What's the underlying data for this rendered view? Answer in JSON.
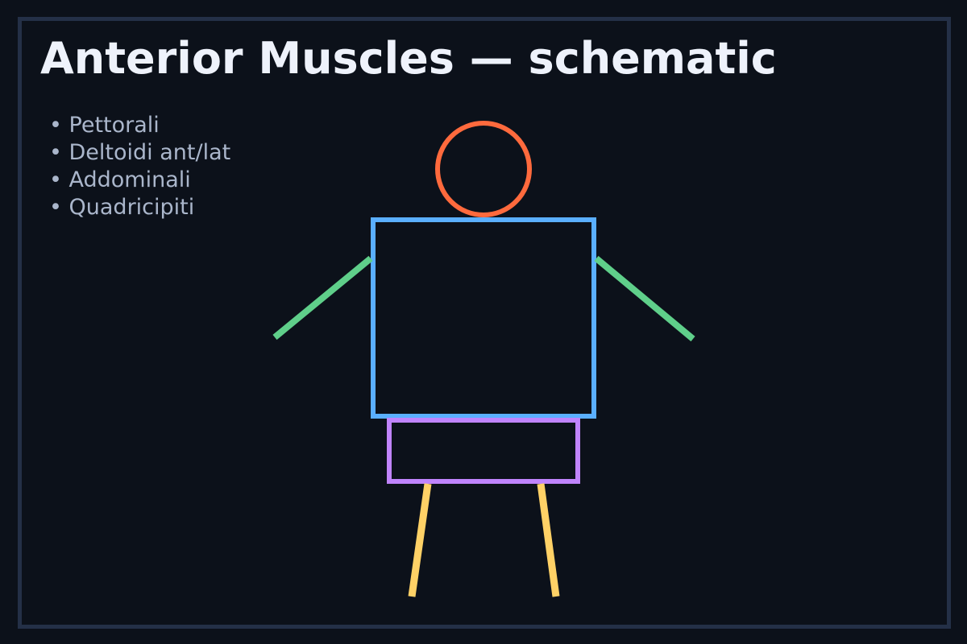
{
  "title": "Anterior Muscles — schematic",
  "muscles": [
    "Pettorali",
    "Deltoidi ant/lat",
    "Addominali",
    "Quadricipiti"
  ],
  "colors": {
    "background": "#0c111a",
    "frame": "#243047",
    "title": "#eef2fb",
    "list_text": "#aab6cb",
    "head": "#ff6a3d",
    "torso": "#5aafff",
    "arms": "#5fcf8a",
    "pelvis": "#c084fc",
    "legs": "#ffd166"
  }
}
